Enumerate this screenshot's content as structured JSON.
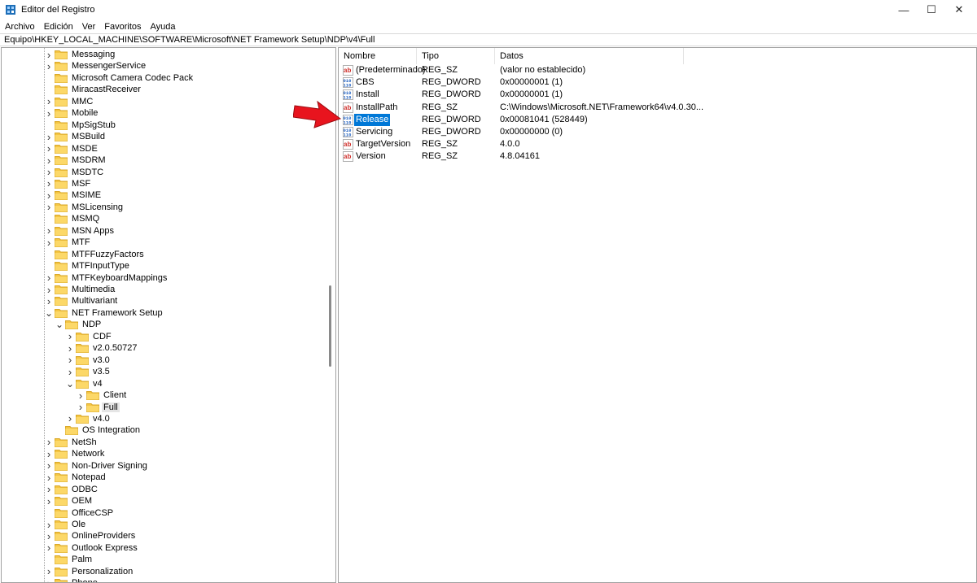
{
  "window": {
    "title": "Editor del Registro",
    "minimize_glyph": "—",
    "maximize_glyph": "☐",
    "close_glyph": "✕"
  },
  "menu": [
    "Archivo",
    "Edición",
    "Ver",
    "Favoritos",
    "Ayuda"
  ],
  "address": "Equipo\\HKEY_LOCAL_MACHINE\\SOFTWARE\\Microsoft\\NET Framework Setup\\NDP\\v4\\Full",
  "tree": {
    "items": [
      {
        "label": "Messaging",
        "depth": 0,
        "expander": ">"
      },
      {
        "label": "MessengerService",
        "depth": 0,
        "expander": ">"
      },
      {
        "label": "Microsoft Camera Codec Pack",
        "depth": 0,
        "expander": ""
      },
      {
        "label": "MiracastReceiver",
        "depth": 0,
        "expander": ""
      },
      {
        "label": "MMC",
        "depth": 0,
        "expander": ">"
      },
      {
        "label": "Mobile",
        "depth": 0,
        "expander": ">"
      },
      {
        "label": "MpSigStub",
        "depth": 0,
        "expander": ""
      },
      {
        "label": "MSBuild",
        "depth": 0,
        "expander": ">"
      },
      {
        "label": "MSDE",
        "depth": 0,
        "expander": ">"
      },
      {
        "label": "MSDRM",
        "depth": 0,
        "expander": ">"
      },
      {
        "label": "MSDTC",
        "depth": 0,
        "expander": ">"
      },
      {
        "label": "MSF",
        "depth": 0,
        "expander": ">"
      },
      {
        "label": "MSIME",
        "depth": 0,
        "expander": ">"
      },
      {
        "label": "MSLicensing",
        "depth": 0,
        "expander": ">"
      },
      {
        "label": "MSMQ",
        "depth": 0,
        "expander": ""
      },
      {
        "label": "MSN Apps",
        "depth": 0,
        "expander": ">"
      },
      {
        "label": "MTF",
        "depth": 0,
        "expander": ">"
      },
      {
        "label": "MTFFuzzyFactors",
        "depth": 0,
        "expander": ""
      },
      {
        "label": "MTFInputType",
        "depth": 0,
        "expander": ""
      },
      {
        "label": "MTFKeyboardMappings",
        "depth": 0,
        "expander": ">"
      },
      {
        "label": "Multimedia",
        "depth": 0,
        "expander": ">"
      },
      {
        "label": "Multivariant",
        "depth": 0,
        "expander": ">"
      },
      {
        "label": "NET Framework Setup",
        "depth": 0,
        "expander": "v"
      },
      {
        "label": "NDP",
        "depth": 1,
        "expander": "v"
      },
      {
        "label": "CDF",
        "depth": 2,
        "expander": ">"
      },
      {
        "label": "v2.0.50727",
        "depth": 2,
        "expander": ">"
      },
      {
        "label": "v3.0",
        "depth": 2,
        "expander": ">"
      },
      {
        "label": "v3.5",
        "depth": 2,
        "expander": ">"
      },
      {
        "label": "v4",
        "depth": 2,
        "expander": "v"
      },
      {
        "label": "Client",
        "depth": 3,
        "expander": ">"
      },
      {
        "label": "Full",
        "depth": 3,
        "expander": ">",
        "selected": true
      },
      {
        "label": "v4.0",
        "depth": 2,
        "expander": ">"
      },
      {
        "label": "OS Integration",
        "depth": 1,
        "expander": ""
      },
      {
        "label": "NetSh",
        "depth": 0,
        "expander": ">"
      },
      {
        "label": "Network",
        "depth": 0,
        "expander": ">"
      },
      {
        "label": "Non-Driver Signing",
        "depth": 0,
        "expander": ">"
      },
      {
        "label": "Notepad",
        "depth": 0,
        "expander": ">"
      },
      {
        "label": "ODBC",
        "depth": 0,
        "expander": ">"
      },
      {
        "label": "OEM",
        "depth": 0,
        "expander": ">"
      },
      {
        "label": "OfficeCSP",
        "depth": 0,
        "expander": ""
      },
      {
        "label": "Ole",
        "depth": 0,
        "expander": ">"
      },
      {
        "label": "OnlineProviders",
        "depth": 0,
        "expander": ">"
      },
      {
        "label": "Outlook Express",
        "depth": 0,
        "expander": ">"
      },
      {
        "label": "Palm",
        "depth": 0,
        "expander": ""
      },
      {
        "label": "Personalization",
        "depth": 0,
        "expander": ">"
      },
      {
        "label": "Phone",
        "depth": 0,
        "expander": ">"
      }
    ]
  },
  "list": {
    "columns": [
      "Nombre",
      "Tipo",
      "Datos"
    ],
    "rows": [
      {
        "icon": "string-value-icon",
        "name": "(Predeterminado)",
        "type": "REG_SZ",
        "data": "(valor no establecido)"
      },
      {
        "icon": "dword-value-icon",
        "name": "CBS",
        "type": "REG_DWORD",
        "data": "0x00000001 (1)"
      },
      {
        "icon": "dword-value-icon",
        "name": "Install",
        "type": "REG_DWORD",
        "data": "0x00000001 (1)"
      },
      {
        "icon": "string-value-icon",
        "name": "InstallPath",
        "type": "REG_SZ",
        "data": "C:\\Windows\\Microsoft.NET\\Framework64\\v4.0.30..."
      },
      {
        "icon": "dword-value-icon",
        "name": "Release",
        "type": "REG_DWORD",
        "data": "0x00081041 (528449)",
        "selected": true
      },
      {
        "icon": "dword-value-icon",
        "name": "Servicing",
        "type": "REG_DWORD",
        "data": "0x00000000 (0)"
      },
      {
        "icon": "string-value-icon",
        "name": "TargetVersion",
        "type": "REG_SZ",
        "data": "4.0.0"
      },
      {
        "icon": "string-value-icon",
        "name": "Version",
        "type": "REG_SZ",
        "data": "4.8.04161"
      }
    ]
  },
  "colors": {
    "selection": "#0078d7",
    "folder": "#f4c542",
    "annotation_arrow": "#e8141e"
  }
}
